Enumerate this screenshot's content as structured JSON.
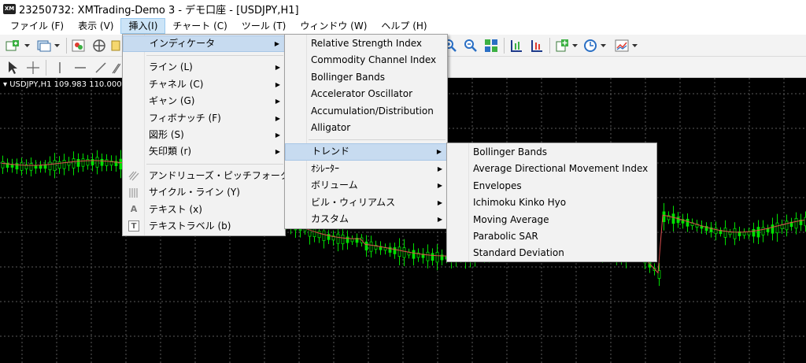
{
  "window": {
    "app_icon": "XM",
    "title": "23250732: XMTrading-Demo 3 - デモ口座 - [USDJPY,H1]"
  },
  "menubar": [
    {
      "id": "file",
      "label": "ファイル (F)"
    },
    {
      "id": "view",
      "label": "表示 (V)"
    },
    {
      "id": "insert",
      "label": "挿入(I)"
    },
    {
      "id": "chart",
      "label": "チャート (C)"
    },
    {
      "id": "tools",
      "label": "ツール (T)"
    },
    {
      "id": "window",
      "label": "ウィンドウ (W)"
    },
    {
      "id": "help",
      "label": "ヘルプ (H)"
    }
  ],
  "chart": {
    "label": "USDJPY,H1  109.983 110.000 1",
    "colors": {
      "background": "#000000",
      "grid": "#5a5a5a",
      "candle": "#00e000",
      "ma_line": "#e05050"
    }
  },
  "insert_menu": {
    "items": [
      {
        "label": "インディケータ",
        "submenu": true,
        "highlighted": true
      },
      {
        "separator": true
      },
      {
        "label": "ライン (L)",
        "submenu": true
      },
      {
        "label": "チャネル (C)",
        "submenu": true
      },
      {
        "label": "ギャン (G)",
        "submenu": true
      },
      {
        "label": "フィボナッチ (F)",
        "submenu": true
      },
      {
        "label": "図形 (S)",
        "submenu": true
      },
      {
        "label": "矢印類 (r)",
        "submenu": true
      },
      {
        "separator": true
      },
      {
        "label": "アンドリューズ・ピッチフォーク (A)",
        "icon": "pitchfork-icon"
      },
      {
        "label": "サイクル・ライン (Y)",
        "icon": "cycle-lines-icon"
      },
      {
        "label": "テキスト (x)",
        "icon": "text-icon",
        "glyph": "A"
      },
      {
        "label": "テキストラベル (b)",
        "icon": "text-label-icon",
        "glyph": "T"
      }
    ]
  },
  "indicator_menu": {
    "items": [
      {
        "label": "Relative Strength Index"
      },
      {
        "label": "Commodity Channel Index"
      },
      {
        "label": "Bollinger Bands"
      },
      {
        "label": "Accelerator Oscillator"
      },
      {
        "label": "Accumulation/Distribution"
      },
      {
        "label": "Alligator"
      },
      {
        "separator": true
      },
      {
        "label": "トレンド",
        "submenu": true,
        "highlighted": true
      },
      {
        "label": "ｵｼﾚｰﾀｰ",
        "submenu": true
      },
      {
        "label": "ボリューム",
        "submenu": true
      },
      {
        "label": "ビル・ウィリアムス",
        "submenu": true
      },
      {
        "label": "カスタム",
        "submenu": true
      }
    ]
  },
  "trend_menu": {
    "items": [
      {
        "label": "Bollinger Bands"
      },
      {
        "label": "Average Directional Movement Index"
      },
      {
        "label": "Envelopes"
      },
      {
        "label": "Ichimoku Kinko Hyo"
      },
      {
        "label": "Moving Average"
      },
      {
        "label": "Parabolic SAR"
      },
      {
        "label": "Standard Deviation"
      }
    ]
  },
  "toolbar": {
    "row1": [
      "new-chart-icon",
      "profiles-icon",
      "market-watch-icon",
      "navigator-icon",
      "zoom-in-icon",
      "zoom-out-icon",
      "tile-windows-icon",
      "chart-shift-icon",
      "auto-scroll-icon",
      "indicators-icon",
      "periods-icon",
      "templates-icon"
    ],
    "row2": [
      "cursor-icon",
      "crosshair-icon",
      "vertical-line-icon",
      "horizontal-line-icon",
      "trendline-icon"
    ]
  }
}
